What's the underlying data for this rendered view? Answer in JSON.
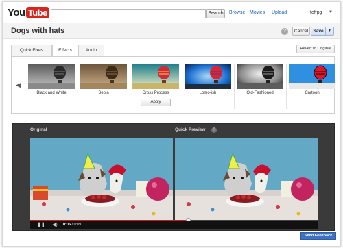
{
  "brand": {
    "you": "You",
    "tube": "Tube",
    "accent": "#d9251d"
  },
  "search": {
    "value": "",
    "button_label": "Search"
  },
  "nav": {
    "browse": "Browse",
    "movies": "Movies",
    "upload": "Upload"
  },
  "user": {
    "name": "toffpg",
    "caret": "▼"
  },
  "title_bar": {
    "title": "Dogs with hats",
    "help": "?",
    "cancel_label": "Cancel",
    "save_label": "Save",
    "save_menu_caret": "▼"
  },
  "tabs": [
    {
      "label": "Quick Fixes",
      "active": false
    },
    {
      "label": "Effects",
      "active": true
    },
    {
      "label": "Audio",
      "active": false
    }
  ],
  "revert_label": "Revert to Original",
  "effects": {
    "prev_arrow": "◀",
    "next_arrow": "▶",
    "items": [
      {
        "label": "Black and White",
        "icon": "balloon-thumbnail"
      },
      {
        "label": "Sepia",
        "icon": "balloon-thumbnail"
      },
      {
        "label": "Cross Process",
        "icon": "balloon-thumbnail",
        "selected": true
      },
      {
        "label": "Lomo-ish",
        "icon": "balloon-thumbnail"
      },
      {
        "label": "Old-Fashioned",
        "icon": "balloon-thumbnail"
      },
      {
        "label": "Cartoon",
        "icon": "balloon-thumbnail"
      }
    ],
    "apply_label": "Apply"
  },
  "preview": {
    "original_label": "Original",
    "quick_preview_label": "Quick Preview",
    "help": "?",
    "play_icon": "pause-icon",
    "volume_icon": "volume-icon",
    "time_current": "0:05",
    "time_separator": " / ",
    "time_total": "0:09",
    "progress": 0.55
  },
  "feedback_label": "Send Feedback"
}
